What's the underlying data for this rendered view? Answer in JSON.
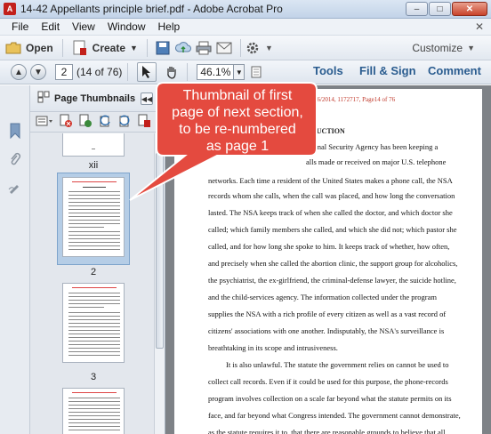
{
  "window": {
    "title": "14-42 Appellants principle brief.pdf - Adobe Acrobat Pro",
    "app_icon": "acrobat-icon"
  },
  "menu": {
    "items": [
      "File",
      "Edit",
      "View",
      "Window",
      "Help"
    ]
  },
  "toolbar": {
    "open_label": "Open",
    "create_label": "Create",
    "customize_label": "Customize"
  },
  "nav": {
    "page_number": "2",
    "page_count": "(14 of 76)",
    "zoom": "46.1%",
    "tabs": [
      "Tools",
      "Fill & Sign",
      "Comment"
    ]
  },
  "thumbnails": {
    "panel_title": "Page Thumbnails",
    "labels": [
      "xii",
      "2",
      "3"
    ]
  },
  "callout": {
    "lines": [
      "Thumbnail of first",
      "page of next section,",
      "to be re-numbered",
      "as page 1"
    ]
  },
  "document": {
    "header": "03/06/2014, 1172717, Page14 of 76",
    "heading": "RODUCTION",
    "lines": [
      "ational Security Agency has been keeping a",
      "alls made or received on major U.S. telephone",
      "networks. Each time a resident of the United States makes a phone call, the NSA",
      "records whom she calls, when the call was placed, and how long the conversation",
      "lasted. The NSA keeps track of when she called the doctor, and which doctor she",
      "called; which family members she called, and which she did not; which pastor she",
      "called, and for how long she spoke to him. It keeps track of whether, how often,",
      "and precisely when she called the abortion clinic, the support group for alcoholics,",
      "the psychiatrist, the ex-girlfriend, the criminal-defense lawyer, the suicide hotline,",
      "and the child-services agency. The information collected under the program",
      "supplies the NSA with a rich profile of every citizen as well as a vast record of",
      "citizens' associations with one another. Indisputably, the NSA's surveillance is",
      "breathtaking in its scope and intrusiveness.",
      "It is also unlawful. The statute the government relies on cannot be used to",
      "collect call records. Even if it could be used for this purpose, the phone-records",
      "program involves collection on a scale far beyond what the statute permits on its",
      "face, and far beyond what Congress intended. The government cannot demonstrate,",
      "as the statute requires it to, that there are reasonable grounds to believe that all"
    ]
  },
  "colors": {
    "callout_fill": "#e44a3f",
    "tab_text": "#2a5c8f",
    "selection": "#b5cde6"
  }
}
